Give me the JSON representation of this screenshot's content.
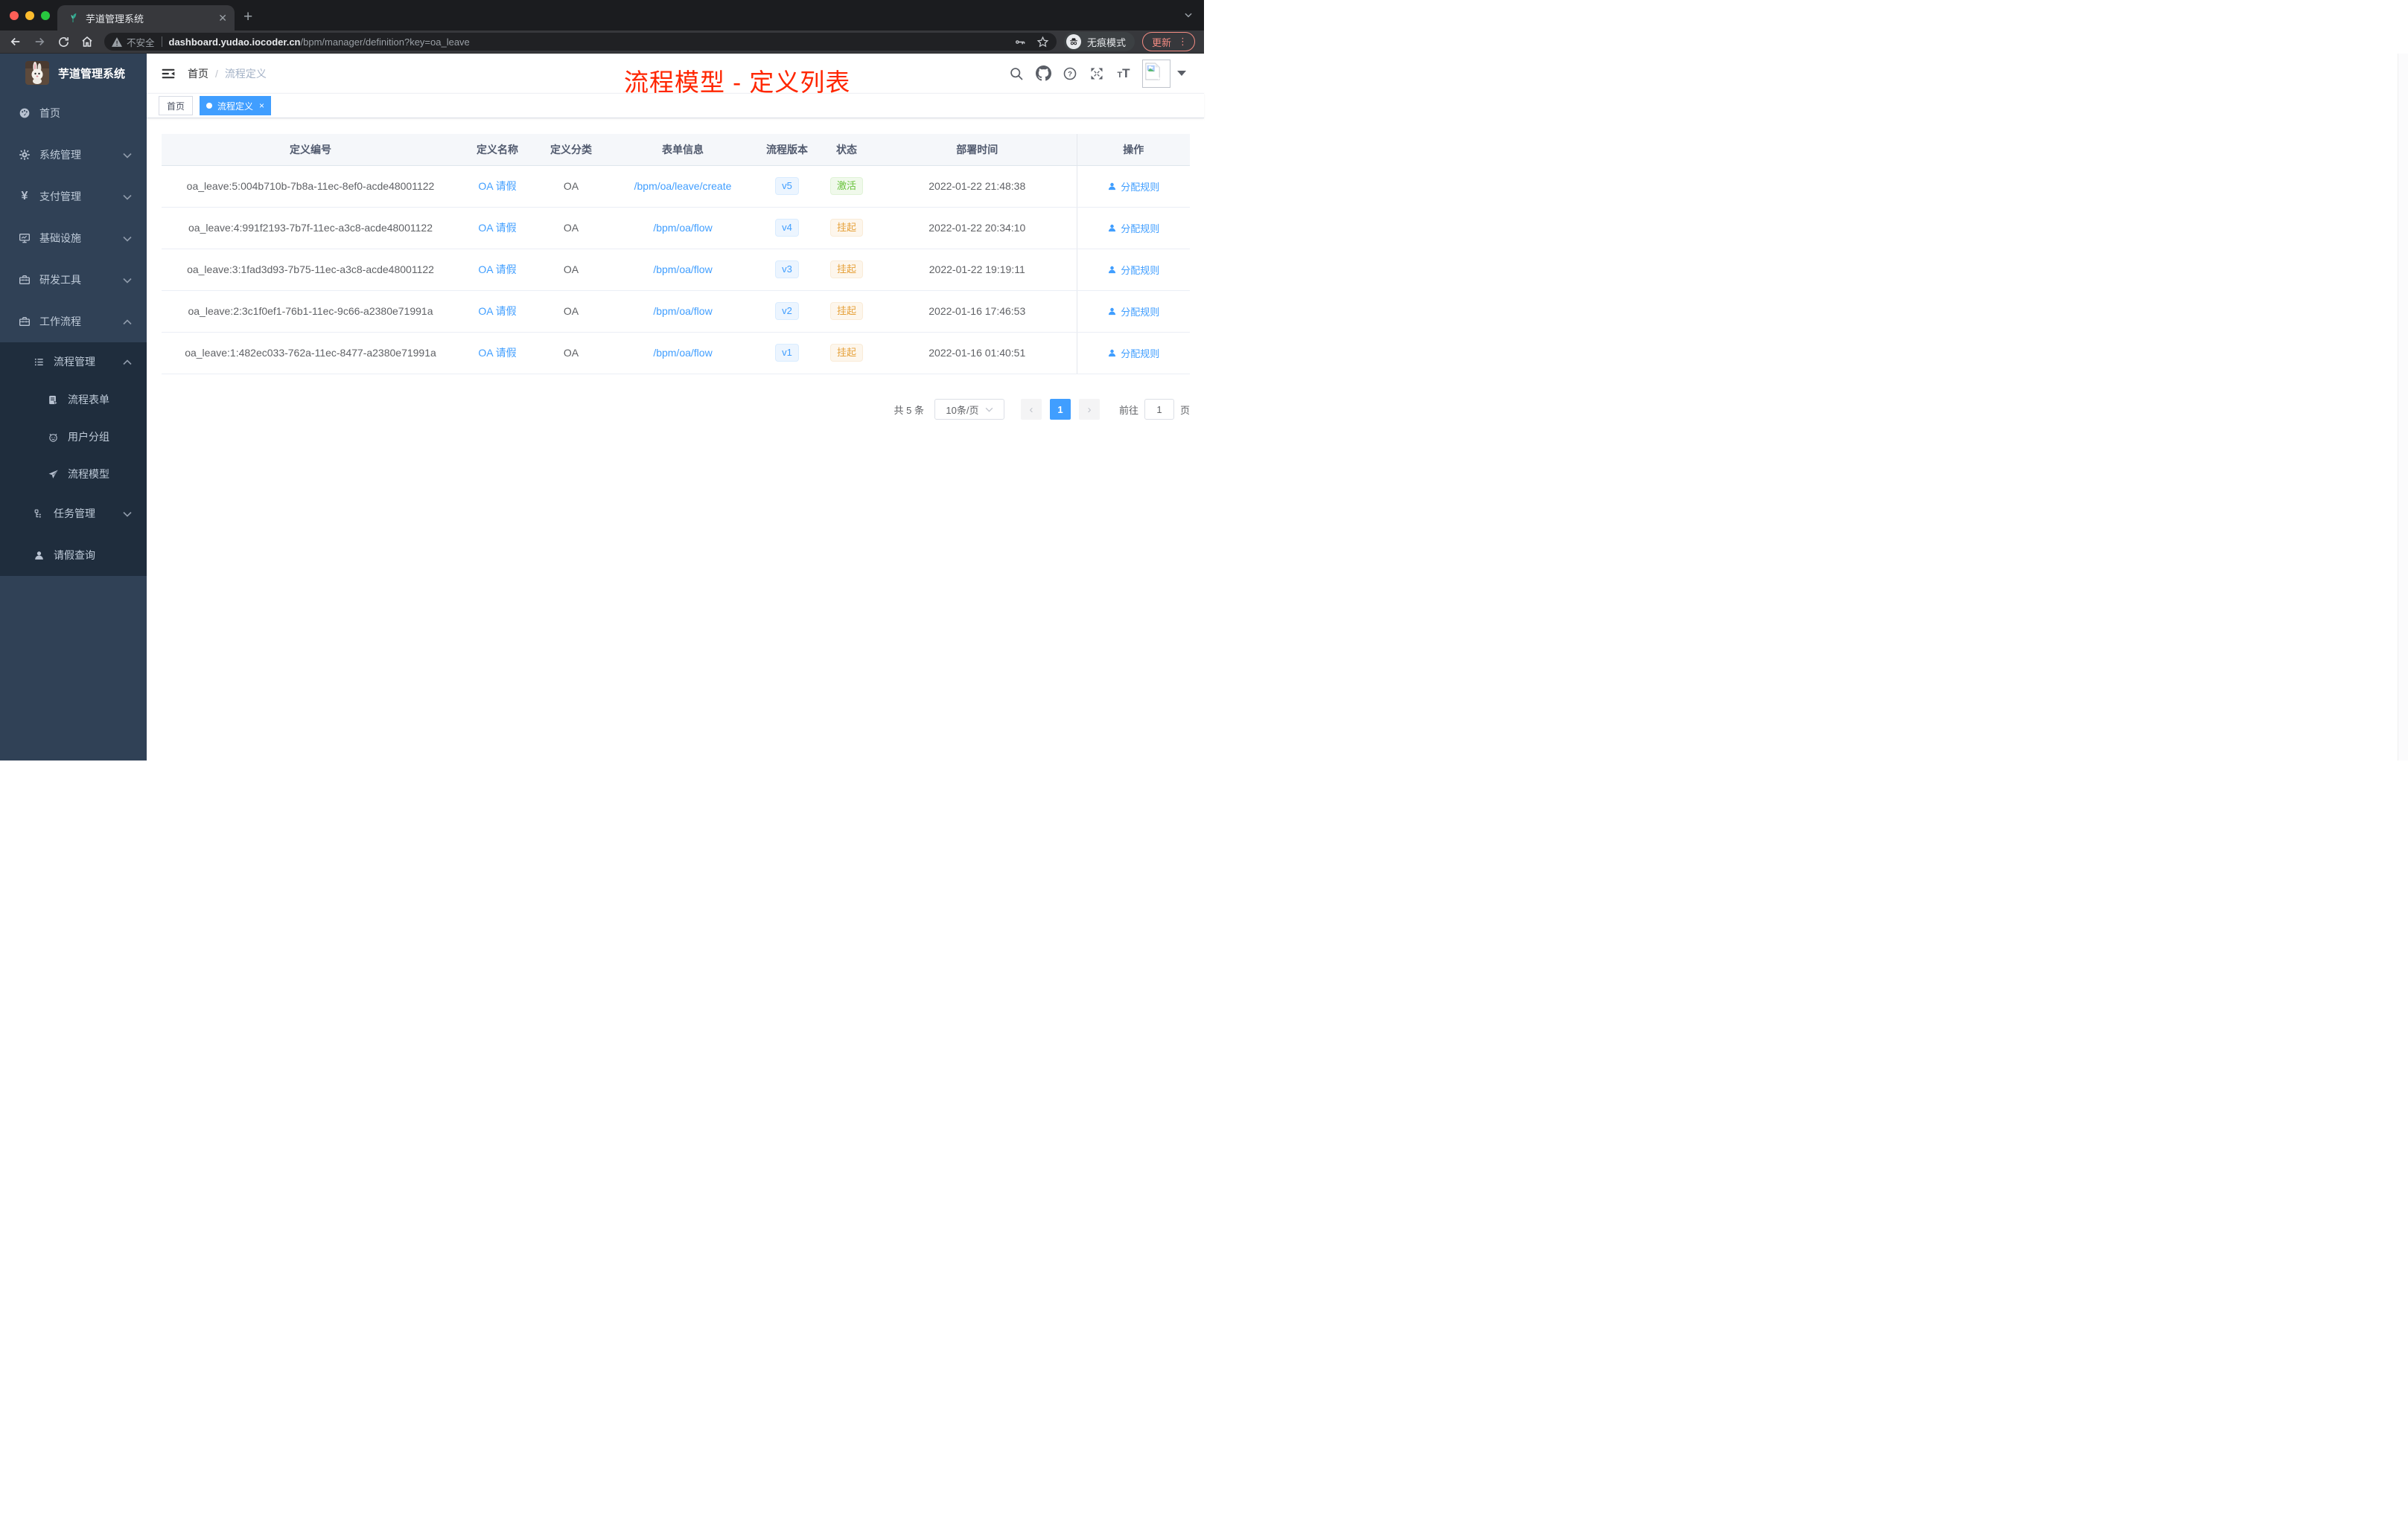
{
  "browser": {
    "tab_title": "芋道管理系统",
    "security_label": "不安全",
    "url_host": "dashboard.yudao.iocoder.cn",
    "url_path": "/bpm/manager/definition?key=oa_leave",
    "incognito_label": "无痕模式",
    "update_label": "更新"
  },
  "sidebar": {
    "app_title": "芋道管理系统",
    "top_items": [
      {
        "label": "首页"
      },
      {
        "label": "系统管理"
      },
      {
        "label": "支付管理"
      },
      {
        "label": "基础设施"
      },
      {
        "label": "研发工具"
      },
      {
        "label": "工作流程"
      }
    ],
    "workflow": {
      "process_group": {
        "label": "流程管理"
      },
      "process_children": [
        {
          "label": "流程表单"
        },
        {
          "label": "用户分组"
        },
        {
          "label": "流程模型"
        }
      ],
      "task_group": {
        "label": "任务管理"
      },
      "leave_item": {
        "label": "请假查询"
      }
    }
  },
  "header": {
    "breadcrumb": {
      "home": "首页",
      "current": "流程定义"
    },
    "annotation": "流程模型 - 定义列表"
  },
  "tags": {
    "home": "首页",
    "active": "流程定义"
  },
  "table": {
    "columns": [
      "定义编号",
      "定义名称",
      "定义分类",
      "表单信息",
      "流程版本",
      "状态",
      "部署时间",
      "操作"
    ],
    "action_label": "分配规则",
    "rows": [
      {
        "id": "oa_leave:5:004b710b-7b8a-11ec-8ef0-acde48001122",
        "name": "OA 请假",
        "category": "OA",
        "form": "/bpm/oa/leave/create",
        "version": "v5",
        "status": "激活",
        "deploy_time": "2022-01-22 21:48:38"
      },
      {
        "id": "oa_leave:4:991f2193-7b7f-11ec-a3c8-acde48001122",
        "name": "OA 请假",
        "category": "OA",
        "form": "/bpm/oa/flow",
        "version": "v4",
        "status": "挂起",
        "deploy_time": "2022-01-22 20:34:10"
      },
      {
        "id": "oa_leave:3:1fad3d93-7b75-11ec-a3c8-acde48001122",
        "name": "OA 请假",
        "category": "OA",
        "form": "/bpm/oa/flow",
        "version": "v3",
        "status": "挂起",
        "deploy_time": "2022-01-22 19:19:11"
      },
      {
        "id": "oa_leave:2:3c1f0ef1-76b1-11ec-9c66-a2380e71991a",
        "name": "OA 请假",
        "category": "OA",
        "form": "/bpm/oa/flow",
        "version": "v2",
        "status": "挂起",
        "deploy_time": "2022-01-16 17:46:53"
      },
      {
        "id": "oa_leave:1:482ec033-762a-11ec-8477-a2380e71991a",
        "name": "OA 请假",
        "category": "OA",
        "form": "/bpm/oa/flow",
        "version": "v1",
        "status": "挂起",
        "deploy_time": "2022-01-16 01:40:51"
      }
    ]
  },
  "pagination": {
    "total_label": "共 5 条",
    "page_size": "10条/页",
    "current_page": "1",
    "goto_label": "前往",
    "goto_value": "1",
    "page_unit": "页"
  },
  "colors": {
    "accent": "#409eff",
    "status_active": "#67c23a",
    "status_suspended": "#e6a23c",
    "sidebar_bg": "#304156",
    "submenu_bg": "#1f2d3d",
    "annotation_red": "#ff2600"
  }
}
